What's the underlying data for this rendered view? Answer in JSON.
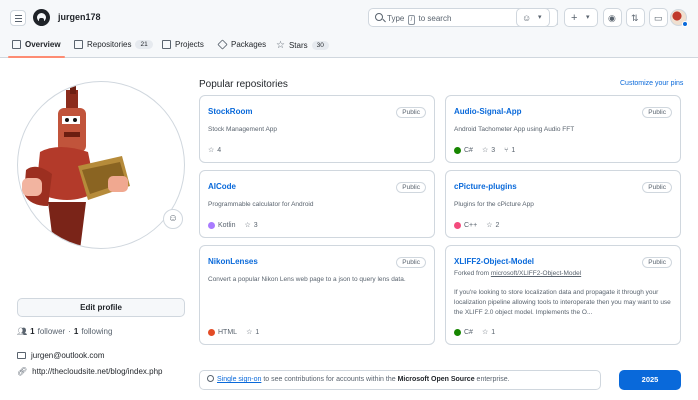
{
  "header": {
    "username": "jurgen178",
    "search_text_pre": "Type",
    "search_key": "/",
    "search_text_post": "to search"
  },
  "tabs": [
    {
      "label": "Overview",
      "count": ""
    },
    {
      "label": "Repositories",
      "count": "21"
    },
    {
      "label": "Projects",
      "count": ""
    },
    {
      "label": "Packages",
      "count": ""
    },
    {
      "label": "Stars",
      "count": "30"
    }
  ],
  "profile": {
    "edit_label": "Edit profile",
    "followers_count": "1",
    "followers_label": "follower",
    "sep": "·",
    "following_count": "1",
    "following_label": "following",
    "email": "jurgen@outlook.com",
    "website": "http://thecloudsite.net/blog/index.php"
  },
  "pinned": {
    "title": "Popular repositories",
    "customize": "Customize your pins",
    "cards": [
      {
        "name": "StockRoom",
        "visibility": "Public",
        "desc": "Stock Management App",
        "lang": "",
        "lang_color": "",
        "stars": "4",
        "forks": ""
      },
      {
        "name": "Audio-Signal-App",
        "visibility": "Public",
        "desc": "Android Tachometer App using Audio FFT",
        "lang": "C#",
        "lang_color": "#178600",
        "stars": "3",
        "forks": "1"
      },
      {
        "name": "AICode",
        "visibility": "Public",
        "desc": "Programmable calculator for Android",
        "lang": "Kotlin",
        "lang_color": "#A97BFF",
        "stars": "3",
        "forks": ""
      },
      {
        "name": "cPicture-plugins",
        "visibility": "Public",
        "desc": "Plugins for the cPicture App",
        "lang": "C++",
        "lang_color": "#f34b7d",
        "stars": "2",
        "forks": ""
      },
      {
        "name": "NikonLenses",
        "visibility": "Public",
        "desc": "Convert a popular Nikon Lens web page to a json to query lens data.",
        "lang": "HTML",
        "lang_color": "#e34c26",
        "stars": "1",
        "forks": ""
      },
      {
        "name": "XLIFF2-Object-Model",
        "visibility": "Public",
        "forked_from_label": "Forked from",
        "forked_from": "microsoft/XLIFF2-Object-Model",
        "desc": "If you're looking to store localization data and propagate it through your localization pipeline allowing tools to interoperate then you may want to use the XLIFF 2.0 object model. Implements the O...",
        "lang": "C#",
        "lang_color": "#178600",
        "stars": "1",
        "forks": ""
      }
    ]
  },
  "contrib": {
    "sso_link": "Single sign-on",
    "sso_text": "to see contributions for accounts within the",
    "sso_org": "Microsoft Open Source",
    "sso_tail": "enterprise.",
    "year": "2025"
  }
}
